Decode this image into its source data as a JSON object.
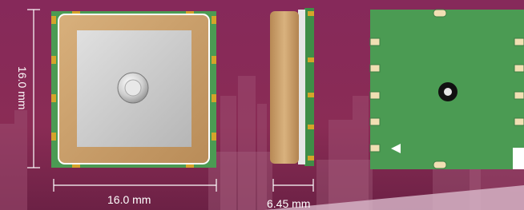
{
  "dimensions": {
    "height_label": "16.0 mm",
    "width_label": "16.0 mm",
    "thickness_label": "6.45 mm"
  },
  "colors": {
    "background": "#7a2650",
    "pcb_green": "#4a9b52",
    "ceramic_tan": "#c99f6b",
    "patch_silver": "#c8c8c8",
    "dimension_line": "#ffffff"
  }
}
